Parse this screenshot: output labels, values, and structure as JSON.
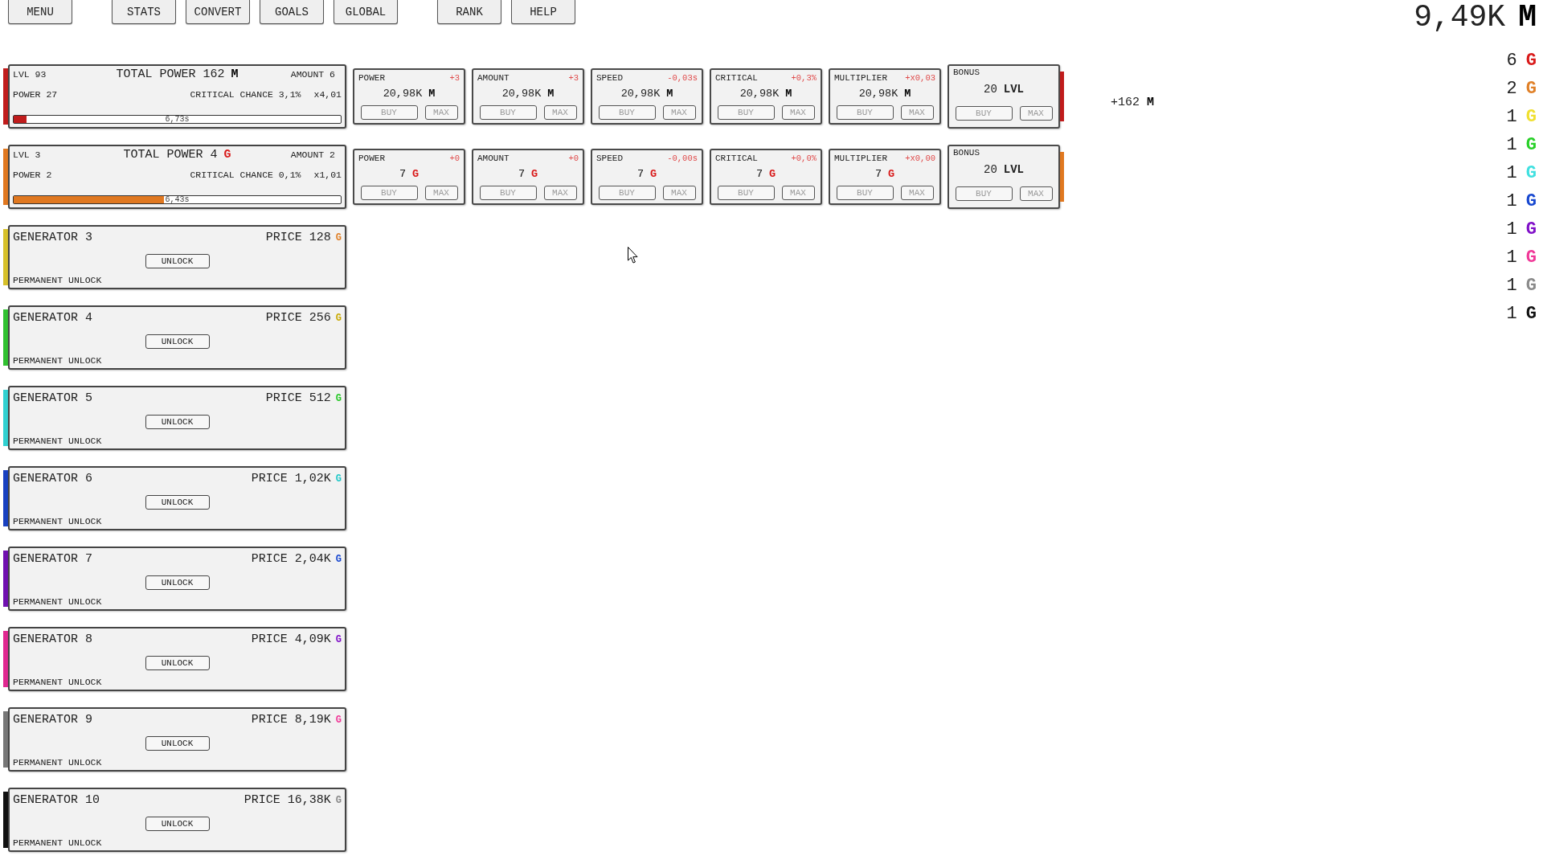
{
  "top_nav": {
    "groups": [
      [
        {
          "label": "MENU"
        }
      ],
      [
        {
          "label": "STATS"
        },
        {
          "label": "CONVERT"
        },
        {
          "label": "GOALS"
        },
        {
          "label": "GLOBAL"
        }
      ],
      [
        {
          "label": "RANK"
        },
        {
          "label": "HELP"
        }
      ]
    ]
  },
  "balance": {
    "value": "9,49K",
    "currency": {
      "text": "M",
      "color": "#000000"
    }
  },
  "generators": [
    {
      "kind": "active",
      "color": "#c01c1c",
      "level_label": "LVL 93",
      "total_power": {
        "label": "TOTAL POWER 162",
        "currency": {
          "text": "M",
          "color": "#000000"
        }
      },
      "amount": "AMOUNT 6",
      "power": "POWER 27",
      "critical_chance": "CRITICAL CHANCE 3,1%",
      "multiplier": "x4,01",
      "progress": {
        "level": 0.04,
        "reading": "6,73s"
      },
      "upgrades": [
        {
          "label": "POWER",
          "delta": "+3",
          "cost": "20,98K",
          "currency": {
            "text": "M",
            "color": "#000000"
          },
          "buttons": [
            {
              "kind": "buy",
              "label": "BUY",
              "disabled": true
            },
            {
              "kind": "max",
              "label": "MAX",
              "disabled": true
            }
          ]
        },
        {
          "label": "AMOUNT",
          "delta": "+3",
          "cost": "20,98K",
          "currency": {
            "text": "M",
            "color": "#000000"
          },
          "buttons": [
            {
              "kind": "buy",
              "label": "BUY",
              "disabled": true
            },
            {
              "kind": "max",
              "label": "MAX",
              "disabled": true
            }
          ]
        },
        {
          "label": "SPEED",
          "delta": "-0,03s",
          "cost": "20,98K",
          "currency": {
            "text": "M",
            "color": "#000000"
          },
          "buttons": [
            {
              "kind": "buy",
              "label": "BUY",
              "disabled": true
            },
            {
              "kind": "max",
              "label": "MAX",
              "disabled": true
            }
          ]
        },
        {
          "label": "CRITICAL",
          "delta": "+0,3%",
          "cost": "20,98K",
          "currency": {
            "text": "M",
            "color": "#000000"
          },
          "buttons": [
            {
              "kind": "buy",
              "label": "BUY",
              "disabled": true
            },
            {
              "kind": "max",
              "label": "MAX",
              "disabled": true
            }
          ]
        },
        {
          "label": "MULTIPLIER",
          "delta": "+x0,03",
          "cost": "20,98K",
          "currency": {
            "text": "M",
            "color": "#000000"
          },
          "buttons": [
            {
              "kind": "buy",
              "label": "BUY",
              "disabled": true
            },
            {
              "kind": "max",
              "label": "MAX",
              "disabled": true
            }
          ]
        }
      ],
      "bonus": {
        "label": "BONUS",
        "value": "20",
        "unit": "LVL",
        "buttons": [
          {
            "kind": "buy",
            "label": "BUY",
            "disabled": true
          },
          {
            "kind": "max",
            "label": "MAX",
            "disabled": true
          }
        ]
      },
      "income": {
        "value": "+162",
        "currency": {
          "text": "M",
          "color": "#000000"
        }
      }
    },
    {
      "kind": "active",
      "color": "#e07820",
      "level_label": "LVL 3",
      "total_power": {
        "label": "TOTAL POWER 4",
        "currency": {
          "text": "G",
          "color": "#d91a1a"
        }
      },
      "amount": "AMOUNT 2",
      "power": "POWER 2",
      "critical_chance": "CRITICAL CHANCE 0,1%",
      "multiplier": "x1,01",
      "progress": {
        "level": 0.46,
        "reading": "6,43s"
      },
      "upgrades": [
        {
          "label": "POWER",
          "delta": "+0",
          "cost": "7",
          "currency": {
            "text": "G",
            "color": "#d91a1a"
          },
          "buttons": [
            {
              "kind": "buy",
              "label": "BUY",
              "disabled": true
            },
            {
              "kind": "max",
              "label": "MAX",
              "disabled": true
            }
          ]
        },
        {
          "label": "AMOUNT",
          "delta": "+0",
          "cost": "7",
          "currency": {
            "text": "G",
            "color": "#d91a1a"
          },
          "buttons": [
            {
              "kind": "buy",
              "label": "BUY",
              "disabled": true
            },
            {
              "kind": "max",
              "label": "MAX",
              "disabled": true
            }
          ]
        },
        {
          "label": "SPEED",
          "delta": "-0,00s",
          "cost": "7",
          "currency": {
            "text": "G",
            "color": "#d91a1a"
          },
          "buttons": [
            {
              "kind": "buy",
              "label": "BUY",
              "disabled": true
            },
            {
              "kind": "max",
              "label": "MAX",
              "disabled": true
            }
          ]
        },
        {
          "label": "CRITICAL",
          "delta": "+0,0%",
          "cost": "7",
          "currency": {
            "text": "G",
            "color": "#d91a1a"
          },
          "buttons": [
            {
              "kind": "buy",
              "label": "BUY",
              "disabled": true
            },
            {
              "kind": "max",
              "label": "MAX",
              "disabled": true
            }
          ]
        },
        {
          "label": "MULTIPLIER",
          "delta": "+x0,00",
          "cost": "7",
          "currency": {
            "text": "G",
            "color": "#d91a1a"
          },
          "buttons": [
            {
              "kind": "buy",
              "label": "BUY",
              "disabled": true
            },
            {
              "kind": "max",
              "label": "MAX",
              "disabled": true
            }
          ]
        }
      ],
      "bonus": {
        "label": "BONUS",
        "value": "20",
        "unit": "LVL",
        "buttons": [
          {
            "kind": "buy",
            "label": "BUY",
            "disabled": true
          },
          {
            "kind": "max",
            "label": "MAX",
            "disabled": true
          }
        ]
      }
    },
    {
      "kind": "locked",
      "color": "#d6c02a",
      "title": "GENERATOR 3",
      "price": {
        "value": "PRICE 128",
        "currency": {
          "text": "G",
          "color": "#e08028"
        }
      },
      "button": {
        "label": "UNLOCK"
      },
      "note": "PERMANENT UNLOCK"
    },
    {
      "kind": "locked",
      "color": "#30c030",
      "title": "GENERATOR 4",
      "price": {
        "value": "PRICE 256",
        "currency": {
          "text": "G",
          "color": "#c9a900"
        }
      },
      "button": {
        "label": "UNLOCK"
      },
      "note": "PERMANENT UNLOCK"
    },
    {
      "kind": "locked",
      "color": "#30d0d0",
      "title": "GENERATOR 5",
      "price": {
        "value": "PRICE 512",
        "currency": {
          "text": "G",
          "color": "#28c828"
        }
      },
      "button": {
        "label": "UNLOCK"
      },
      "note": "PERMANENT UNLOCK"
    },
    {
      "kind": "locked",
      "color": "#1840c0",
      "title": "GENERATOR 6",
      "price": {
        "value": "PRICE 1,02K",
        "currency": {
          "text": "G",
          "color": "#20c8c8"
        }
      },
      "button": {
        "label": "UNLOCK"
      },
      "note": "PERMANENT UNLOCK"
    },
    {
      "kind": "locked",
      "color": "#7010b0",
      "title": "GENERATOR 7",
      "price": {
        "value": "PRICE 2,04K",
        "currency": {
          "text": "G",
          "color": "#1848d0"
        }
      },
      "button": {
        "label": "UNLOCK"
      },
      "note": "PERMANENT UNLOCK"
    },
    {
      "kind": "locked",
      "color": "#e02890",
      "title": "GENERATOR 8",
      "price": {
        "value": "PRICE 4,09K",
        "currency": {
          "text": "G",
          "color": "#8010c8"
        }
      },
      "button": {
        "label": "UNLOCK"
      },
      "note": "PERMANENT UNLOCK"
    },
    {
      "kind": "locked",
      "color": "#777777",
      "title": "GENERATOR 9",
      "price": {
        "value": "PRICE 8,19K",
        "currency": {
          "text": "G",
          "color": "#f03898"
        }
      },
      "button": {
        "label": "UNLOCK"
      },
      "note": "PERMANENT UNLOCK"
    },
    {
      "kind": "locked",
      "color": "#111111",
      "title": "GENERATOR 10",
      "price": {
        "value": "PRICE 16,38K",
        "currency": {
          "text": "G",
          "color": "#8a8a8a"
        }
      },
      "button": {
        "label": "UNLOCK"
      },
      "note": "PERMANENT UNLOCK"
    }
  ],
  "totals": [
    {
      "amount": "6",
      "currency": {
        "text": "G",
        "color": "#d91a1a"
      }
    },
    {
      "amount": "2",
      "currency": {
        "text": "G",
        "color": "#e08028"
      }
    },
    {
      "amount": "1",
      "currency": {
        "text": "G",
        "color": "#f0e030"
      }
    },
    {
      "amount": "1",
      "currency": {
        "text": "G",
        "color": "#28d028"
      }
    },
    {
      "amount": "1",
      "currency": {
        "text": "G",
        "color": "#40e0e0"
      }
    },
    {
      "amount": "1",
      "currency": {
        "text": "G",
        "color": "#1848d0"
      }
    },
    {
      "amount": "1",
      "currency": {
        "text": "G",
        "color": "#8010c8"
      }
    },
    {
      "amount": "1",
      "currency": {
        "text": "G",
        "color": "#f03898"
      }
    },
    {
      "amount": "1",
      "currency": {
        "text": "G",
        "color": "#8a8a8a"
      }
    },
    {
      "amount": "1",
      "currency": {
        "text": "G",
        "color": "#111111"
      }
    }
  ]
}
